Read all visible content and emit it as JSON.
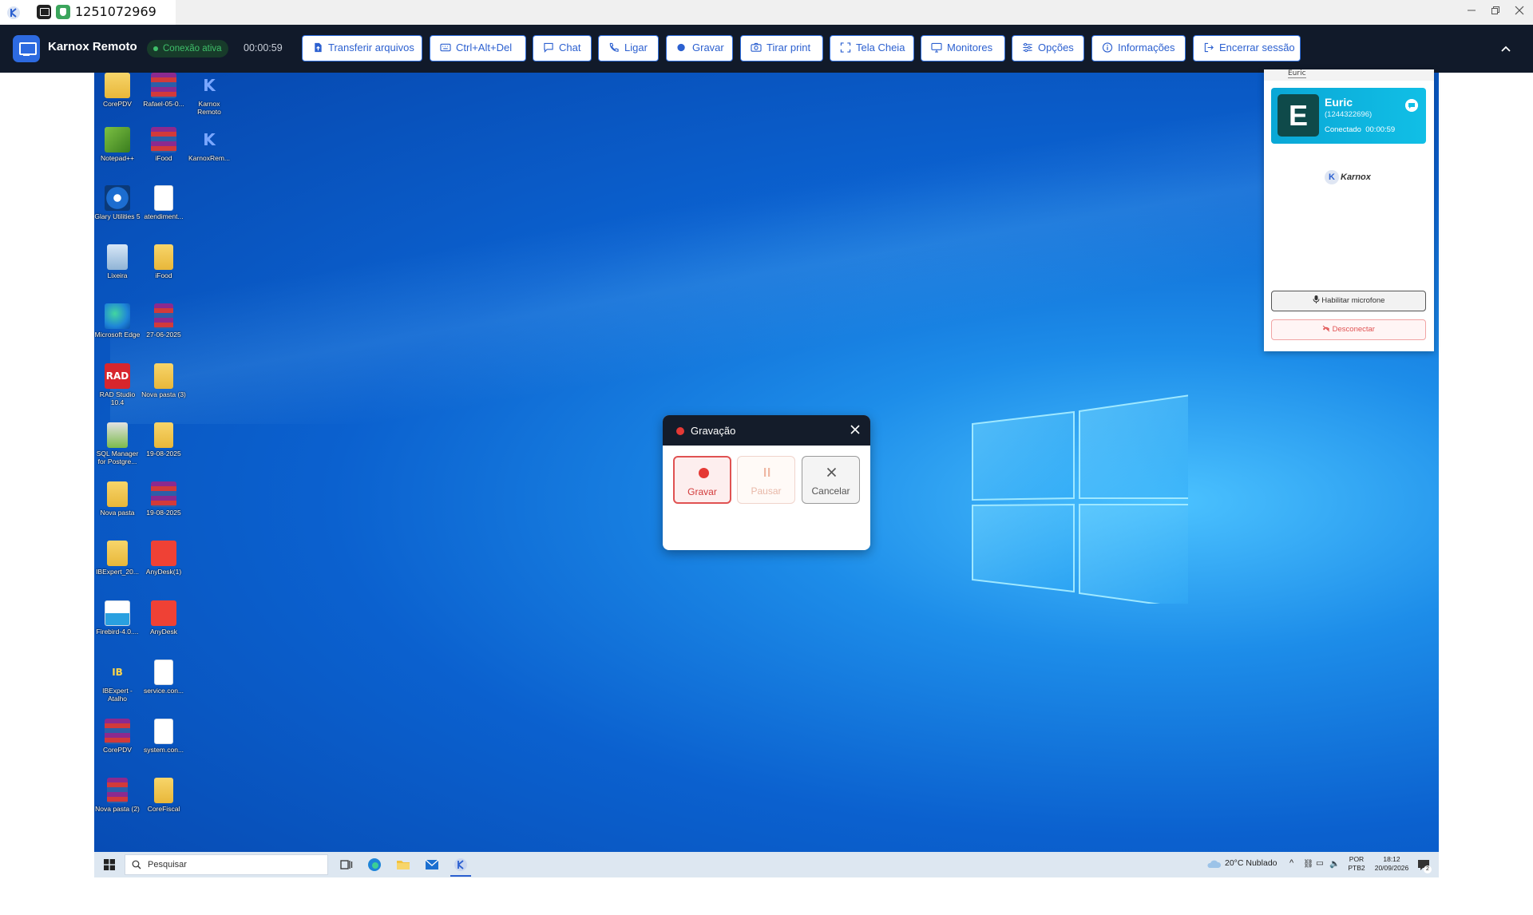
{
  "window": {
    "session_id": "1251072969",
    "controls": [
      "minimize",
      "restore",
      "close"
    ]
  },
  "toolbar": {
    "app_name": "Karnox Remoto",
    "connection_status": "Conexão ativa",
    "elapsed": "00:00:59",
    "buttons": [
      {
        "label": "Transferir arquivos",
        "icon": "file-upload-icon"
      },
      {
        "label": "Ctrl+Alt+Del",
        "icon": "keyboard-icon"
      },
      {
        "label": "Chat",
        "icon": "chat-icon"
      },
      {
        "label": "Ligar",
        "icon": "phone-icon"
      },
      {
        "label": "Gravar",
        "icon": "record-dot-icon"
      },
      {
        "label": "Tirar print",
        "icon": "camera-icon"
      },
      {
        "label": "Tela Cheia",
        "icon": "fullscreen-icon"
      },
      {
        "label": "Monitores",
        "icon": "monitor-icon"
      },
      {
        "label": "Opções",
        "icon": "sliders-icon"
      },
      {
        "label": "Informações",
        "icon": "info-icon"
      },
      {
        "label": "Encerrar sessão",
        "icon": "logout-icon"
      }
    ],
    "accent": "#2f6fe0",
    "background": "#111a2a"
  },
  "desktop": {
    "icons": [
      {
        "label": "CorePDV",
        "type": "folder"
      },
      {
        "label": "Rafael-05-0...",
        "type": "rar"
      },
      {
        "label": "Karnox Remoto",
        "type": "karnox"
      },
      {
        "label": "Notepad++",
        "type": "notepad"
      },
      {
        "label": "iFood",
        "type": "rar"
      },
      {
        "label": "KarnoxRem...",
        "type": "karnox"
      },
      {
        "label": "Glary Utilities 5",
        "type": "glary"
      },
      {
        "label": "atendiment...",
        "type": "file"
      },
      {
        "label": "Lixeira",
        "type": "bin"
      },
      {
        "label": "iFood",
        "type": "folder"
      },
      {
        "label": "Microsoft Edge",
        "type": "edge"
      },
      {
        "label": "27-06-2025",
        "type": "rar"
      },
      {
        "label": "RAD Studio 10.4",
        "type": "rad"
      },
      {
        "label": "Nova pasta (3)",
        "type": "folder"
      },
      {
        "label": "SQL Manager for Postgre...",
        "type": "sql"
      },
      {
        "label": "19-08-2025",
        "type": "folder"
      },
      {
        "label": "Nova pasta",
        "type": "folder"
      },
      {
        "label": "19-08-2025",
        "type": "rar"
      },
      {
        "label": "IBExpert_20...",
        "type": "folder"
      },
      {
        "label": "AnyDesk(1)",
        "type": "anydesk"
      },
      {
        "label": "Firebird-4.0....",
        "type": "firebird"
      },
      {
        "label": "AnyDesk",
        "type": "anydesk"
      },
      {
        "label": "IBExpert - Atalho",
        "type": "ibexpert"
      },
      {
        "label": "service.con...",
        "type": "file"
      },
      {
        "label": "CorePDV",
        "type": "rar"
      },
      {
        "label": "system.con...",
        "type": "file"
      },
      {
        "label": "Nova pasta (2)",
        "type": "folder"
      },
      {
        "label": "CoreFiscal",
        "type": "folder"
      }
    ],
    "taskbar": {
      "search_placeholder": "Pesquisar",
      "weather": "20°C  Nublado",
      "lang_top": "POR",
      "lang_bottom": "PTB2",
      "time": "18:12",
      "date": "20/09/2026",
      "notif_count": "2"
    }
  },
  "recording_dialog": {
    "title": "Gravação",
    "buttons": [
      {
        "label": "Gravar",
        "state": "active",
        "icon": "record-icon"
      },
      {
        "label": "Pausar",
        "state": "disabled",
        "icon": "pause-icon"
      },
      {
        "label": "Cancelar",
        "state": "normal",
        "icon": "x-icon"
      }
    ],
    "record_color": "#e53935"
  },
  "side_panel": {
    "header_text": "Euric",
    "user_initial": "E",
    "user_name": "Euric",
    "user_id": "(1244322696)",
    "user_status": "Conectado",
    "user_timer": "00:00:59",
    "logo_text": "Karnox",
    "mic_button": "Habilitar microfone",
    "disconnect_button": "Desconectar"
  }
}
